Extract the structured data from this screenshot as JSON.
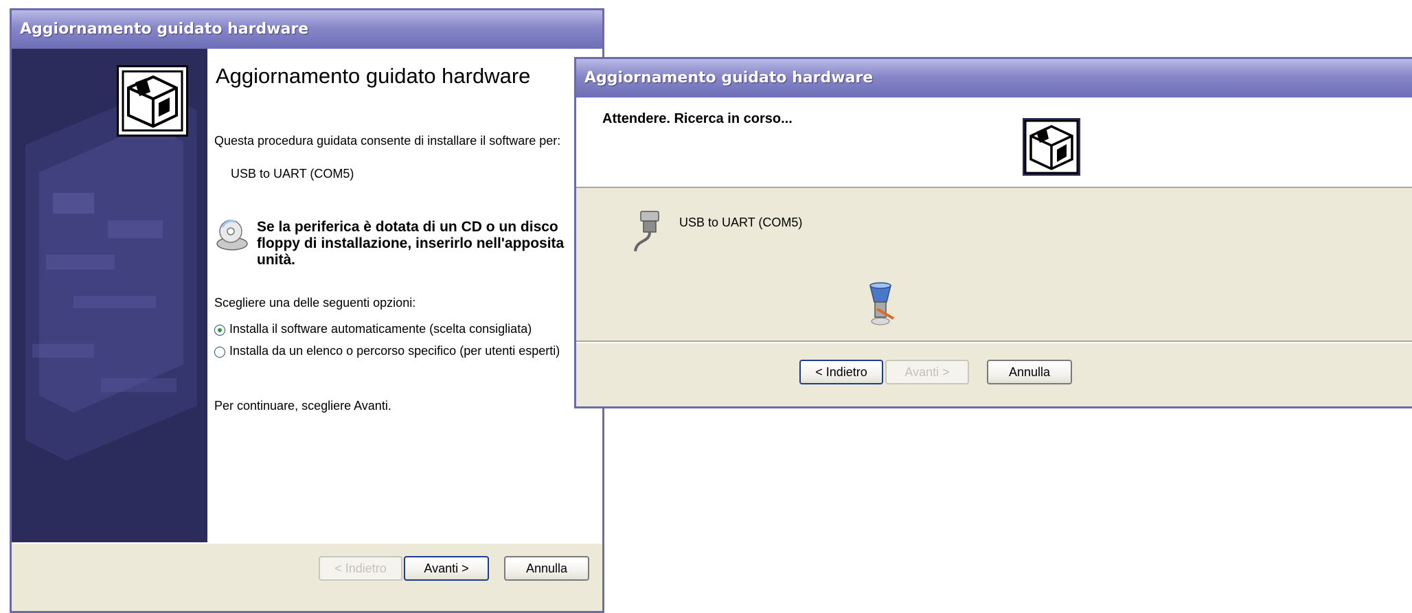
{
  "window1": {
    "title": "Aggiornamento guidato hardware",
    "heading": "Aggiornamento guidato hardware",
    "intro": "Questa procedura guidata consente di installare il software per:",
    "device_name": "USB to UART (COM5)",
    "cd_notice": [
      "Se la periferica è dotata di un CD o un disco",
      "floppy di installazione, inserirlo nell'apposita",
      "unità."
    ],
    "choose_prompt": "Scegliere una delle seguenti opzioni:",
    "options": [
      {
        "label": "Installa il software automaticamente (scelta consigliata)",
        "selected": true
      },
      {
        "label": "Installa da un elenco o percorso specifico (per utenti esperti)",
        "selected": false
      }
    ],
    "continue_hint": "Per continuare, scegliere Avanti.",
    "buttons": {
      "back": "< Indietro",
      "next": "Avanti >",
      "cancel": "Annulla"
    }
  },
  "window2": {
    "title": "Aggiornamento guidato hardware",
    "status": "Attendere. Ricerca in corso...",
    "device_name": "USB to UART (COM5)",
    "buttons": {
      "back": "< Indietro",
      "next": "Avanti >",
      "cancel": "Annulla"
    }
  },
  "icons": {
    "wizard": "hardware-wizard-icon",
    "cd": "cd-disk-icon",
    "usb": "usb-cable-icon",
    "search": "search-flashlight-icon"
  },
  "colors": {
    "titlebar": "#7b7bc0",
    "banner": "#2b2b5c",
    "button_border": "#1d3c8a",
    "window_bg": "#ece9d8"
  }
}
